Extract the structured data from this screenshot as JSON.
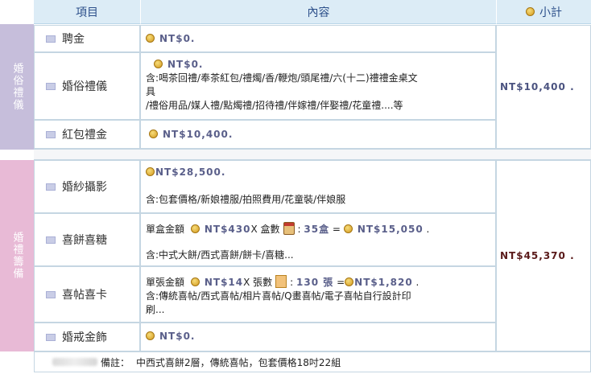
{
  "header": {
    "col_item": "項目",
    "col_content": "內容",
    "col_subtotal": "小計",
    "subtotal_icon": "coin-icon"
  },
  "groups": [
    {
      "label": "婚俗禮儀",
      "subtotal": "NT$10,400 .",
      "rows": [
        {
          "item": "聘金",
          "amount": "NT$0."
        },
        {
          "item": "婚俗禮儀",
          "amount": "NT$0.",
          "desc_lines": [
            "含:喝茶回禮/奉茶紅包/禮燭/香/鞭炮/頭尾禮/六(十二)禮禮金桌文",
            "具",
            "/禮俗用品/媒人禮/點燭禮/招待禮/伴嫁禮/伴娶禮/花童禮....等"
          ]
        },
        {
          "item": "紅包禮金",
          "amount": "NT$10,400."
        }
      ]
    },
    {
      "label": "婚禮籌備",
      "subtotal": "NT$45,370 .",
      "rows": [
        {
          "item": "婚紗攝影",
          "amount": "NT$28,500.",
          "desc": "含:包套價格/新娘禮服/拍照費用/花童裝/伴娘服"
        },
        {
          "item": "喜餅喜糖",
          "calc_label": "單盒金額",
          "unit_price": "NT$430",
          "qty_label": "X 盒數",
          "qty": "35盒",
          "equals": "=",
          "total": "NT$15,050",
          "end": ".",
          "desc": "含:中式大餅/西式喜餅/餅卡/喜糖..."
        },
        {
          "item": "喜帖喜卡",
          "calc_label": "單張金額",
          "unit_price": "NT$14",
          "qty_label": "X 張數",
          "qty": "130 張",
          "equals": "=",
          "total": "NT$1,820",
          "end": ".",
          "desc_lines": [
            "含:傳統喜帖/西式喜帖/相片喜帖/Q畫喜帖/電子喜帖自行設計印",
            "刷..."
          ]
        },
        {
          "item": "婚戒金飾",
          "amount": "NT$0."
        }
      ]
    }
  ],
  "footer": {
    "note_label": "備註：",
    "note_text": "中西式喜餅2層，傳統喜帖，包套價格18吋22組"
  },
  "colors": {
    "header_bg": "#dcecf6",
    "group1_bg": "#c6bedb",
    "group2_bg": "#e8bad6",
    "amount": "#5a5f8a",
    "subtotal2": "#5a1a1a"
  }
}
